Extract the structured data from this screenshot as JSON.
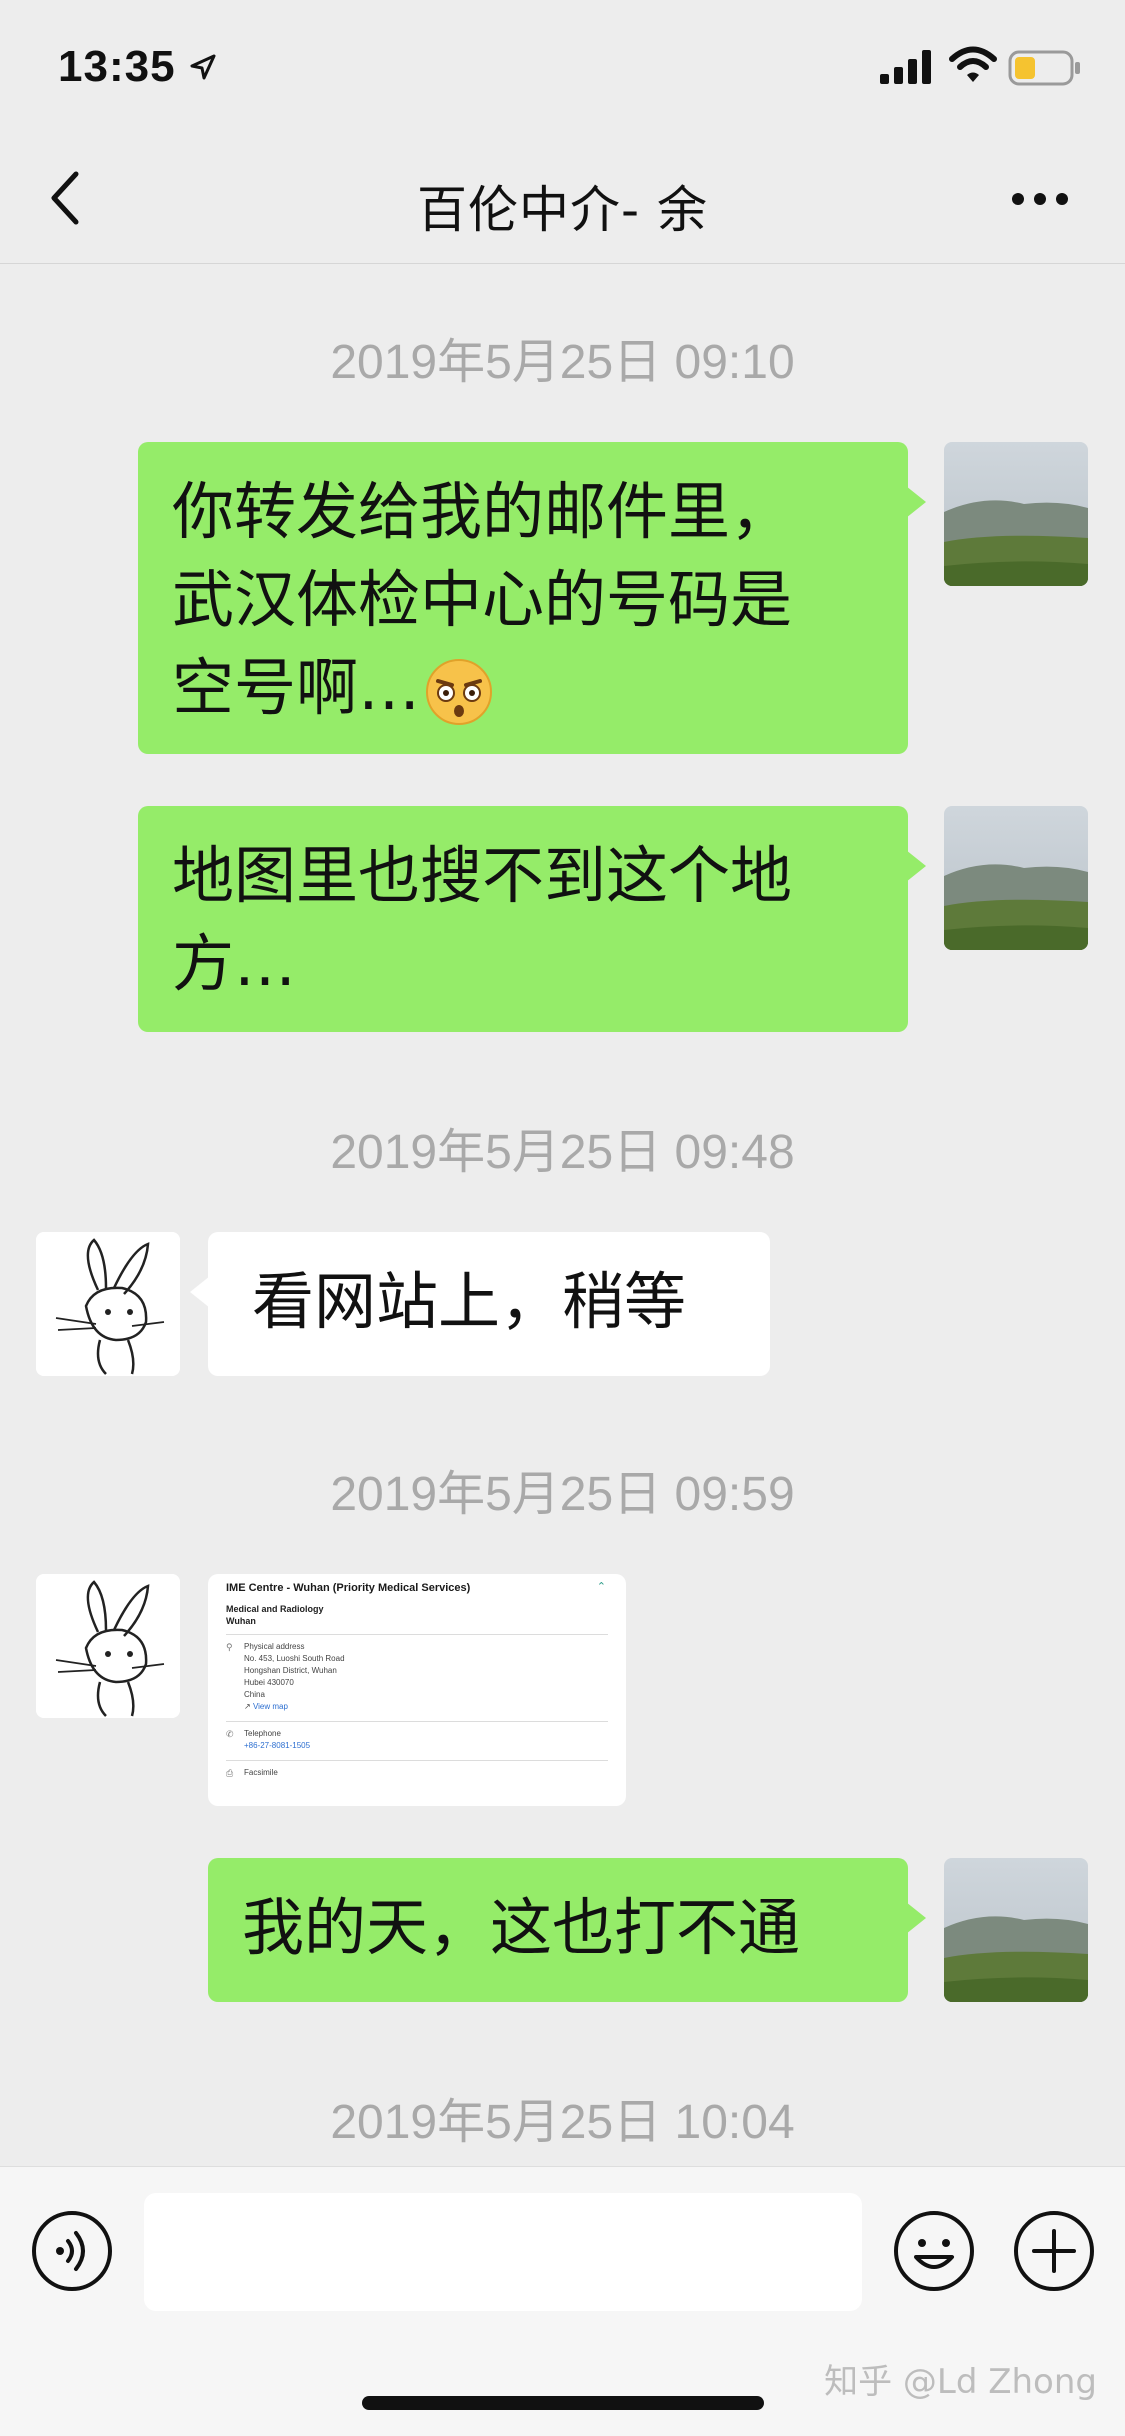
{
  "status_bar": {
    "time": "13:35",
    "icons": [
      "location-arrow-icon",
      "cellular-signal-icon",
      "wifi-icon",
      "battery-icon"
    ],
    "battery_color": "#f5c330"
  },
  "nav": {
    "title": "百伦中介- 余",
    "back_icon": "chevron-left-icon",
    "more_icon": "more-dots-icon"
  },
  "colors": {
    "my_bubble": "#95ec69",
    "their_bubble": "#ffffff",
    "background": "#ededed",
    "timestamp": "#a9a9a9"
  },
  "messages": [
    {
      "type": "timestamp",
      "text": "2019年5月25日 09:10"
    },
    {
      "type": "text",
      "from": "me",
      "lines": [
        "你转发给我的邮件里，",
        "武汉体检中心的号码是",
        "空号啊…"
      ],
      "emoji": "astonished-face-emoji"
    },
    {
      "type": "text",
      "from": "me",
      "lines": [
        "地图里也搜不到这个地",
        "方…"
      ]
    },
    {
      "type": "timestamp",
      "text": "2019年5月25日 09:48"
    },
    {
      "type": "text",
      "from": "them",
      "lines": [
        "看网站上，稍等"
      ]
    },
    {
      "type": "timestamp",
      "text": "2019年5月25日 09:59"
    },
    {
      "type": "image",
      "from": "them",
      "card": {
        "title": "IME Centre - Wuhan (Priority Medical Services)",
        "category": "Medical and Radiology",
        "city": "Wuhan",
        "address_label": "Physical address",
        "address_lines": [
          "No. 453, Luoshi South Road",
          "Hongshan District, Wuhan",
          "Hubei 430070",
          "China"
        ],
        "map_link": "View map",
        "telephone_label": "Telephone",
        "telephone": "+86-27-8081-1505",
        "fax_label": "Facsimile"
      }
    },
    {
      "type": "text",
      "from": "me",
      "lines": [
        "我的天，这也打不通"
      ]
    },
    {
      "type": "timestamp",
      "text": "2019年5月25日 10:04"
    }
  ],
  "input_bar": {
    "placeholder": "",
    "icons": [
      "voice-icon",
      "emoji-icon",
      "plus-icon"
    ]
  },
  "watermark": "知乎 @Ld Zhong"
}
